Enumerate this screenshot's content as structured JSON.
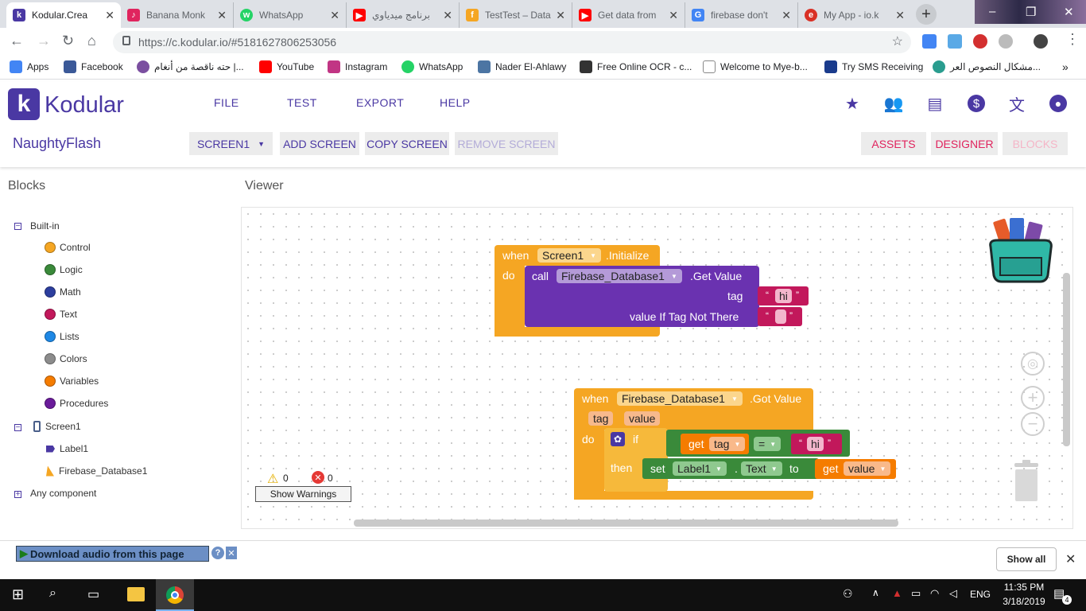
{
  "browser": {
    "tabs": [
      {
        "title": "Kodular.Crea",
        "active": true,
        "favicon_color": "#4a38a3",
        "favicon_letter": "k"
      },
      {
        "title": "Banana Monk",
        "active": false,
        "favicon_color": "#e0245e",
        "favicon_letter": "♪"
      },
      {
        "title": "WhatsApp",
        "active": false,
        "favicon_color": "#25d366",
        "favicon_letter": "w"
      },
      {
        "title": "برنامج ميدياوي",
        "active": false,
        "favicon_color": "#ff0000",
        "favicon_letter": "▶"
      },
      {
        "title": "TestTest – Data",
        "active": false,
        "favicon_color": "#f5a623",
        "favicon_letter": "f"
      },
      {
        "title": "Get data from",
        "active": false,
        "favicon_color": "#ff0000",
        "favicon_letter": "▶"
      },
      {
        "title": "firebase don't",
        "active": false,
        "favicon_color": "#4285f4",
        "favicon_letter": "G"
      },
      {
        "title": "My App - io.k",
        "active": false,
        "favicon_color": "#d93025",
        "favicon_letter": "e"
      }
    ],
    "url": "https://c.kodular.io/#5181627806253056",
    "bookmarks": [
      {
        "label": "Apps",
        "color": "#4285f4"
      },
      {
        "label": "Facebook",
        "color": "#3b5998"
      },
      {
        "label": "حته ناقصة من أنغام |...",
        "color": "#7b4fa0"
      },
      {
        "label": "YouTube",
        "color": "#ff0000"
      },
      {
        "label": "Instagram",
        "color": "#c13584"
      },
      {
        "label": "WhatsApp",
        "color": "#25d366"
      },
      {
        "label": "Nader El-Ahlawy",
        "color": "#4c75a3"
      },
      {
        "label": "Free Online OCR - c...",
        "color": "#333333"
      },
      {
        "label": "Welcome to Mye-b...",
        "color": "#888888"
      },
      {
        "label": "Try SMS Receiving",
        "color": "#1a3b8c"
      },
      {
        "label": "مشكال النصوص العر...",
        "color": "#2a9d8f"
      }
    ]
  },
  "app": {
    "brand": "Kodular",
    "logo_letter": "k",
    "menu": [
      "FILE",
      "TEST",
      "EXPORT",
      "HELP"
    ],
    "project_name": "NaughtyFlash",
    "screen_select": "SCREEN1",
    "add_screen": "ADD SCREEN",
    "copy_screen": "COPY SCREEN",
    "remove_screen": "REMOVE SCREEN",
    "assets": "ASSETS",
    "designer": "DESIGNER",
    "blocks": "BLOCKS",
    "accent": "#4a38a3"
  },
  "panel": {
    "title": "Blocks",
    "builtin": "Built-in",
    "categories": [
      {
        "label": "Control",
        "color": "#f5a623"
      },
      {
        "label": "Logic",
        "color": "#3a8a3a"
      },
      {
        "label": "Math",
        "color": "#2c3e9e"
      },
      {
        "label": "Text",
        "color": "#c2185b"
      },
      {
        "label": "Lists",
        "color": "#1e88e5"
      },
      {
        "label": "Colors",
        "color": "#8c8c8c"
      },
      {
        "label": "Variables",
        "color": "#f57c00"
      },
      {
        "label": "Procedures",
        "color": "#6a1b9a"
      }
    ],
    "screen": "Screen1",
    "components": [
      "Label1",
      "Firebase_Database1"
    ],
    "any_component": "Any component"
  },
  "viewer": {
    "title": "Viewer",
    "block1": {
      "when": "when",
      "component": "Screen1",
      "event": ".Initialize",
      "do": "do",
      "call": "call",
      "call_component": "Firebase_Database1",
      "method": ".Get Value",
      "tag_label": "tag",
      "tag_value": "hi",
      "default_label": "value If Tag Not There",
      "default_value": ""
    },
    "block2": {
      "when": "when",
      "component": "Firebase_Database1",
      "event": ".Got Value",
      "param1": "tag",
      "param2": "value",
      "do": "do",
      "if": "if",
      "then": "then",
      "get": "get",
      "get_var": "tag",
      "op": "=",
      "compare": "hi",
      "set": "set",
      "set_component": "Label1",
      "dot": ".",
      "set_prop": "Text",
      "to": "to",
      "get2": "get",
      "get2_var": "value"
    },
    "warnings": "0",
    "errors": "0",
    "show_warnings": "Show Warnings"
  },
  "downloads": {
    "download_audio": "Download audio from this page",
    "show_all": "Show all"
  },
  "taskbar": {
    "time": "11:35 PM",
    "date": "3/18/2019",
    "lang": "ENG",
    "notifications": "4"
  }
}
